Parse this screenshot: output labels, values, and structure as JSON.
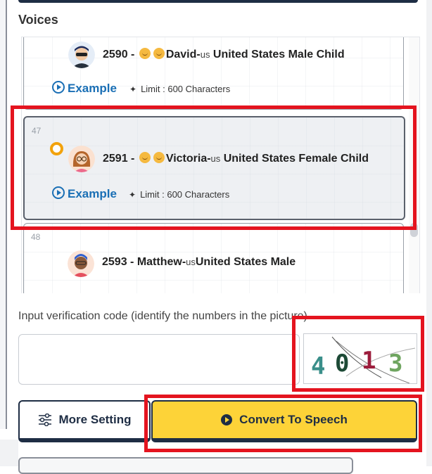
{
  "section": {
    "title": "Voices"
  },
  "voices": [
    {
      "number": "",
      "name_prefix": "2590 - ",
      "name": "David-",
      "name_small": "us",
      "desc": " United States Male Child",
      "example": "Example",
      "limit": "Limit : 600 Characters",
      "has_emoji": true
    },
    {
      "number": "47",
      "name_prefix": "2591 - ",
      "name": "Victoria-",
      "name_small": "us",
      "desc": " United States Female Child",
      "example": "Example",
      "limit": "Limit : 600 Characters",
      "has_emoji": true,
      "selected": true
    },
    {
      "number": "48",
      "name_prefix": "2593 - ",
      "name": "Matthew-",
      "name_small": "us",
      "desc": "United States Male",
      "has_emoji": false
    }
  ],
  "verification": {
    "label": "Input verification code (identify the numbers in the picture)",
    "input_value": "",
    "captcha_digits": [
      "4",
      "0",
      "1",
      "3"
    ],
    "captcha_colors": [
      "#3a8f8a",
      "#1d4a36",
      "#9c1d3c",
      "#6fa560"
    ]
  },
  "buttons": {
    "more_setting": "More Setting",
    "convert": "Convert To Speech"
  },
  "colors": {
    "accent": "#fdd338",
    "navy": "#1e2d44",
    "link": "#1a6fb5",
    "highlight": "#e4141f",
    "radio": "#f2a20c"
  }
}
